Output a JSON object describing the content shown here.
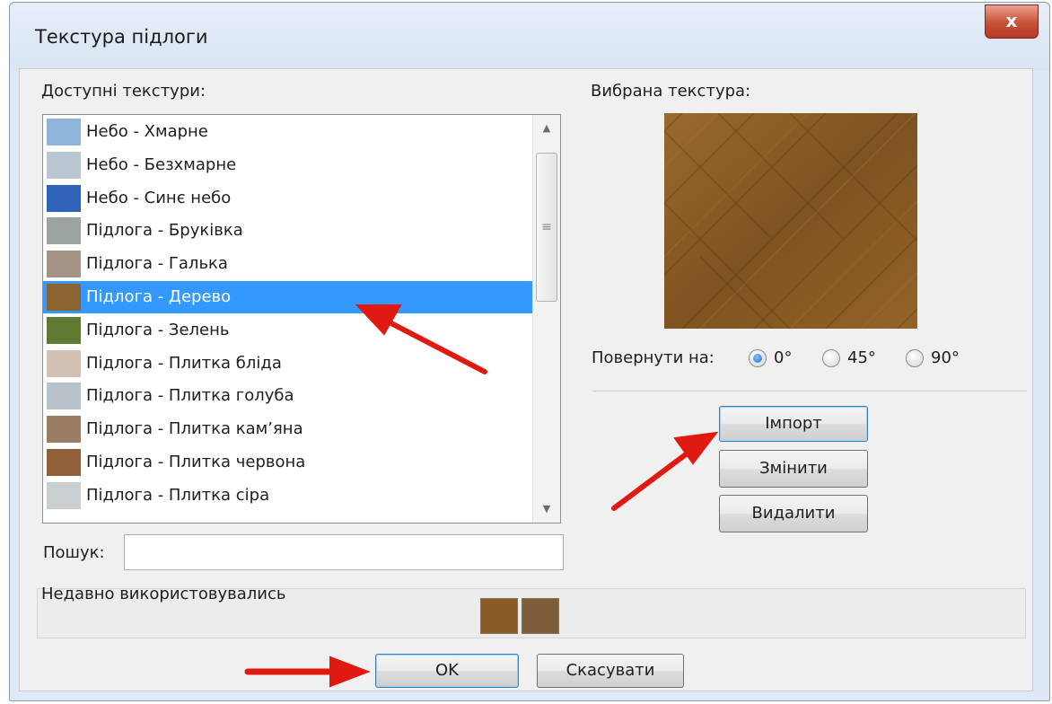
{
  "window": {
    "title": "Текстура підлоги",
    "close_glyph": "x"
  },
  "textures": {
    "label": "Доступні текстури:",
    "items": [
      {
        "label": "Небо - Хмарне",
        "swatch": "#8fb6da"
      },
      {
        "label": "Небо - Безхмарне",
        "swatch": "#b9c5cf"
      },
      {
        "label": "Небо - Синє небо",
        "swatch": "#2f63b8"
      },
      {
        "label": "Підлога - Бруківка",
        "swatch": "#9aa3a0"
      },
      {
        "label": "Підлога - Галька",
        "swatch": "#a49384"
      },
      {
        "label": "Підлога - Дерево",
        "swatch": "#8b6330"
      },
      {
        "label": "Підлога - Зелень",
        "swatch": "#5f7a33"
      },
      {
        "label": "Підлога - Плитка бліда",
        "swatch": "#d3c1b4"
      },
      {
        "label": "Підлога - Плитка голуба",
        "swatch": "#b9c2c8"
      },
      {
        "label": "Підлога - Плитка кам’яна",
        "swatch": "#9b7d64"
      },
      {
        "label": "Підлога - Плитка червона",
        "swatch": "#8e5f38"
      },
      {
        "label": "Підлога - Плитка сіра",
        "swatch": "#c9cfd1"
      }
    ],
    "selected": "Підлога - Дерево"
  },
  "search": {
    "label": "Пошук:",
    "value": ""
  },
  "recent": {
    "label": "Недавно використовувались",
    "swatches": [
      "#8a5b27",
      "#7d5d3a"
    ]
  },
  "selected_texture": {
    "label": "Вибрана текстура:",
    "rotate_label": "Повернути на:",
    "rotation_options": [
      "0°",
      "45°",
      "90°"
    ],
    "rotation_selected": "0°"
  },
  "actions": {
    "import": "Імпорт",
    "change": "Змінити",
    "delete": "Видалити"
  },
  "footer": {
    "ok": "OK",
    "cancel": "Скасувати"
  },
  "colors": {
    "selection": "#3399ff",
    "annotation_arrow": "#e01a10",
    "title_bar": "#dfe9f5"
  }
}
